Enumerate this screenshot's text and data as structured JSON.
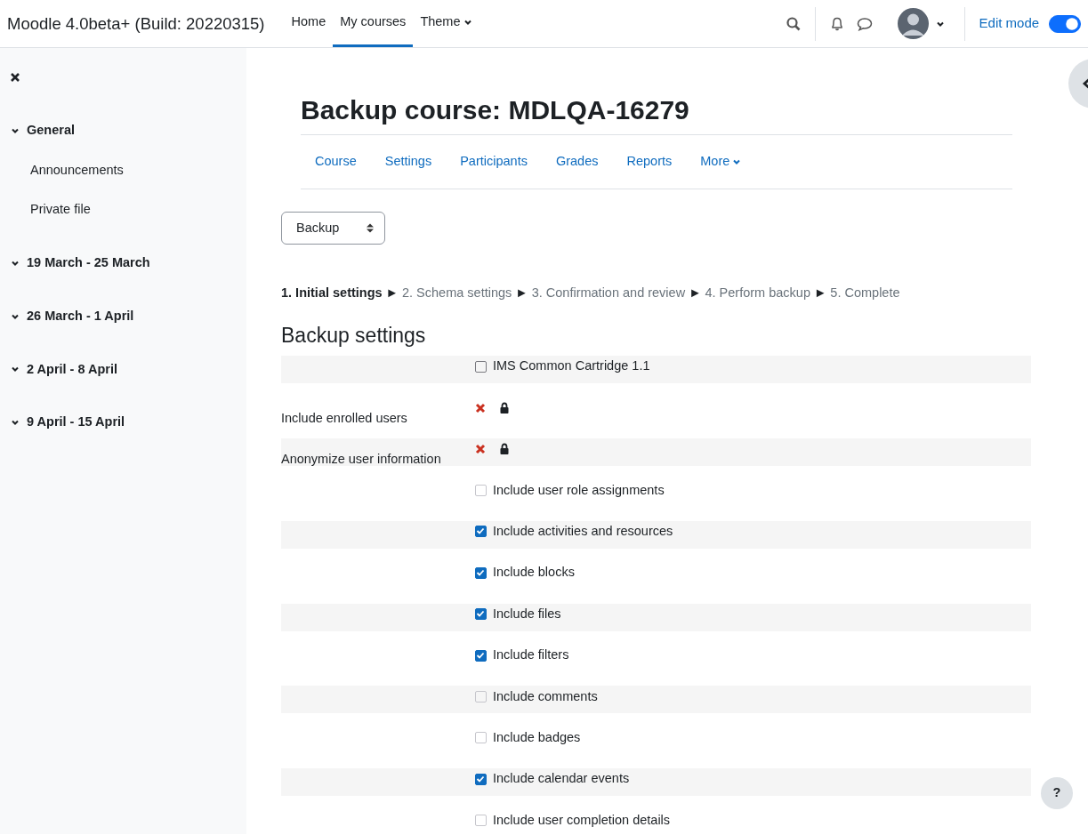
{
  "navbar": {
    "site_name": "Moodle 4.0beta+ (Build: 20220315)",
    "links": [
      {
        "label": "Home",
        "selected": false,
        "dropdown": false
      },
      {
        "label": "My courses",
        "selected": true,
        "dropdown": false
      },
      {
        "label": "Theme",
        "selected": false,
        "dropdown": true
      }
    ],
    "edit_mode": {
      "label": "Edit mode",
      "on": true
    }
  },
  "sidebar": {
    "items": [
      {
        "label": "General",
        "expanded": true,
        "children": [
          {
            "label": "Announcements"
          },
          {
            "label": "Private file"
          }
        ]
      },
      {
        "label": "19 March - 25 March",
        "expanded": true
      },
      {
        "label": "26 March - 1 April",
        "expanded": true
      },
      {
        "label": "2 April - 8 April",
        "expanded": true
      },
      {
        "label": "9 April - 15 April",
        "expanded": true
      }
    ]
  },
  "page": {
    "title": "Backup course: MDLQA-16279",
    "tabs": [
      {
        "label": "Course",
        "dropdown": false
      },
      {
        "label": "Settings",
        "dropdown": false
      },
      {
        "label": "Participants",
        "dropdown": false
      },
      {
        "label": "Grades",
        "dropdown": false
      },
      {
        "label": "Reports",
        "dropdown": false
      },
      {
        "label": "More",
        "dropdown": true
      }
    ],
    "select": {
      "value": "Backup"
    },
    "separator": "►",
    "steps": [
      {
        "label": "1. Initial settings",
        "selected": true
      },
      {
        "label": "2. Schema settings",
        "selected": false
      },
      {
        "label": "3. Confirmation and review",
        "selected": false
      },
      {
        "label": "4. Perform backup",
        "selected": false
      },
      {
        "label": "5. Complete",
        "selected": false
      }
    ],
    "section_title": "Backup settings",
    "settings": [
      {
        "kind": "checkbox",
        "option": "IMS Common Cartridge 1.1",
        "checked": false,
        "disabled": false
      },
      {
        "kind": "locked",
        "label": "Include enrolled users"
      },
      {
        "kind": "locked",
        "label": "Anonymize user information"
      },
      {
        "kind": "checkbox",
        "option": "Include user role assignments",
        "checked": false,
        "disabled": true
      },
      {
        "kind": "checkbox",
        "option": "Include activities and resources",
        "checked": true,
        "disabled": false
      },
      {
        "kind": "checkbox",
        "option": "Include blocks",
        "checked": true,
        "disabled": false
      },
      {
        "kind": "checkbox",
        "option": "Include files",
        "checked": true,
        "disabled": false
      },
      {
        "kind": "checkbox",
        "option": "Include filters",
        "checked": true,
        "disabled": false
      },
      {
        "kind": "checkbox",
        "option": "Include comments",
        "checked": false,
        "disabled": true
      },
      {
        "kind": "checkbox",
        "option": "Include badges",
        "checked": false,
        "disabled": true
      },
      {
        "kind": "checkbox",
        "option": "Include calendar events",
        "checked": true,
        "disabled": false
      },
      {
        "kind": "checkbox",
        "option": "Include user completion details",
        "checked": false,
        "disabled": true
      }
    ]
  },
  "help_button": {
    "label": "?"
  }
}
